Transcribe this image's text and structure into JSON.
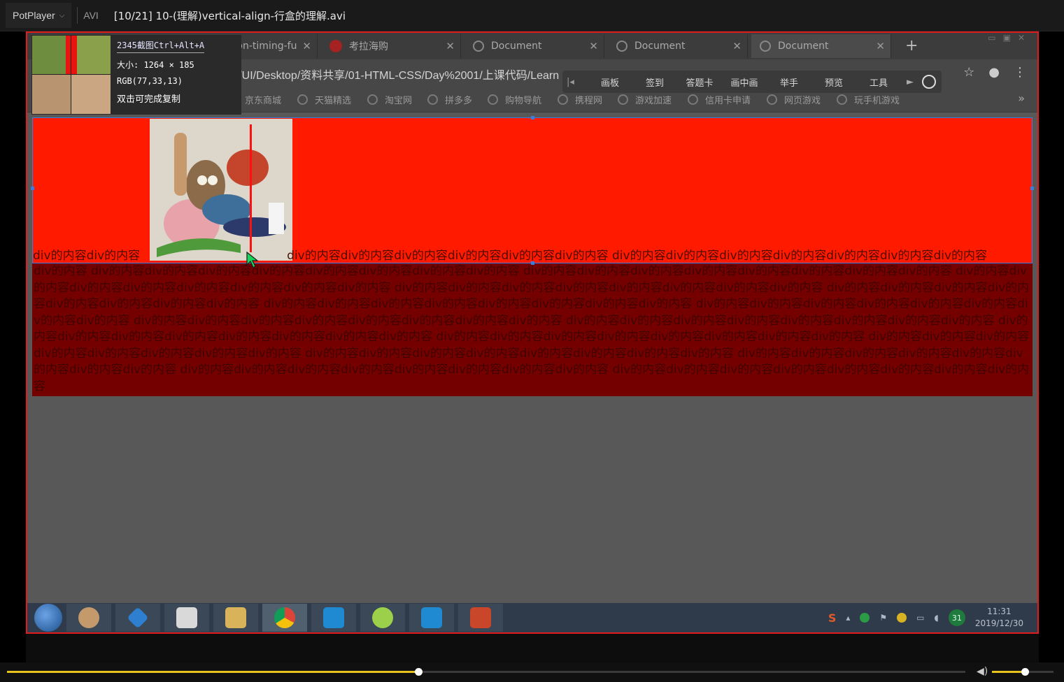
{
  "player": {
    "brand": "PotPlayer",
    "format": "AVI",
    "file_title": "[10/21] 10-(理解)vertical-align-行盒的理解.avi",
    "seek_progress": 0.429,
    "volume_level": 0.53
  },
  "browser": {
    "tabs": [
      {
        "label": "nsition-timing-fu"
      },
      {
        "label": "考拉海购"
      },
      {
        "label": "Document"
      },
      {
        "label": "Document"
      },
      {
        "label": "Document"
      }
    ],
    "address": "C:/Users/UI/Desktop/资料共享/01-HTML-CSS/Day%2001/上课代码/Learn",
    "bookmarks": [
      "京东商城",
      "天猫精选",
      "淘宝网",
      "拼多多",
      "购物导航",
      "携程网",
      "游戏加速",
      "信用卡申请",
      "网页游戏",
      "玩手机游戏"
    ],
    "bookmark_more": "»"
  },
  "float_toolbar": {
    "items": [
      "画板",
      "签到",
      "答题卡",
      "画中画",
      "举手",
      "预览",
      "工具"
    ]
  },
  "capture_tool": {
    "title": "2345截图Ctrl+Alt+A",
    "size": "大小: 1264 × 185",
    "rgb": "RGB(77,33,13)",
    "hint": "双击可完成复制"
  },
  "webpage": {
    "first_line_left": "div的内容div的内容",
    "first_line_right": "div的内容div的内容div的内容div的内容div的内容div的内容 div的内容div的内容div的内容div的内容div的内容div的内容div的内容",
    "body_text": "div的内容 div的内容div的内容div的内容div的内容div的内容div的内容div的内容div的内容 div的内容div的内容div的内容div的内容div的内容div的内容div的内容div的内容 div的内容div的内容div的内容div的内容div的内容div的内容div的内容div的内容 div的内容div的内容div的内容div的内容div的内容div的内容div的内容div的内容 div的内容div的内容div的内容div的内容div的内容div的内容div的内容div的内容 div的内容div的内容div的内容div的内容div的内容div的内容div的内容div的内容 div的内容div的内容div的内容div的内容div的内容div的内容div的内容div的内容 div的内容div的内容div的内容div的内容div的内容div的内容div的内容div的内容 div的内容div的内容div的内容div的内容div的内容div的内容div的内容div的内容 div的内容div的内容div的内容div的内容div的内容div的内容div的内容div的内容 div的内容div的内容div的内容div的内容div的内容div的内容div的内容div的内容 div的内容div的内容div的内容div的内容div的内容div的内容div的内容div的内容 div的内容div的内容div的内容div的内容div的内容div的内容div的内容div的内容 div的内容div的内容div的内容div的内容div的内容div的内容div的内容div的内容 div的内容div的内容div的内容div的内容div的内容div的内容div的内容div的内容 div的内容div的内容div的内容div的内容div的内容div的内容div的内容div的内容"
  },
  "taskbar": {
    "tray_badge": "31",
    "time": "11:31",
    "date": "2019/12/30"
  },
  "colors": {
    "red_box": "#ff1a00",
    "dark_text_bg": "#750000",
    "accent_yellow": "#e8c21e",
    "selection_border": "#e11c1c"
  }
}
